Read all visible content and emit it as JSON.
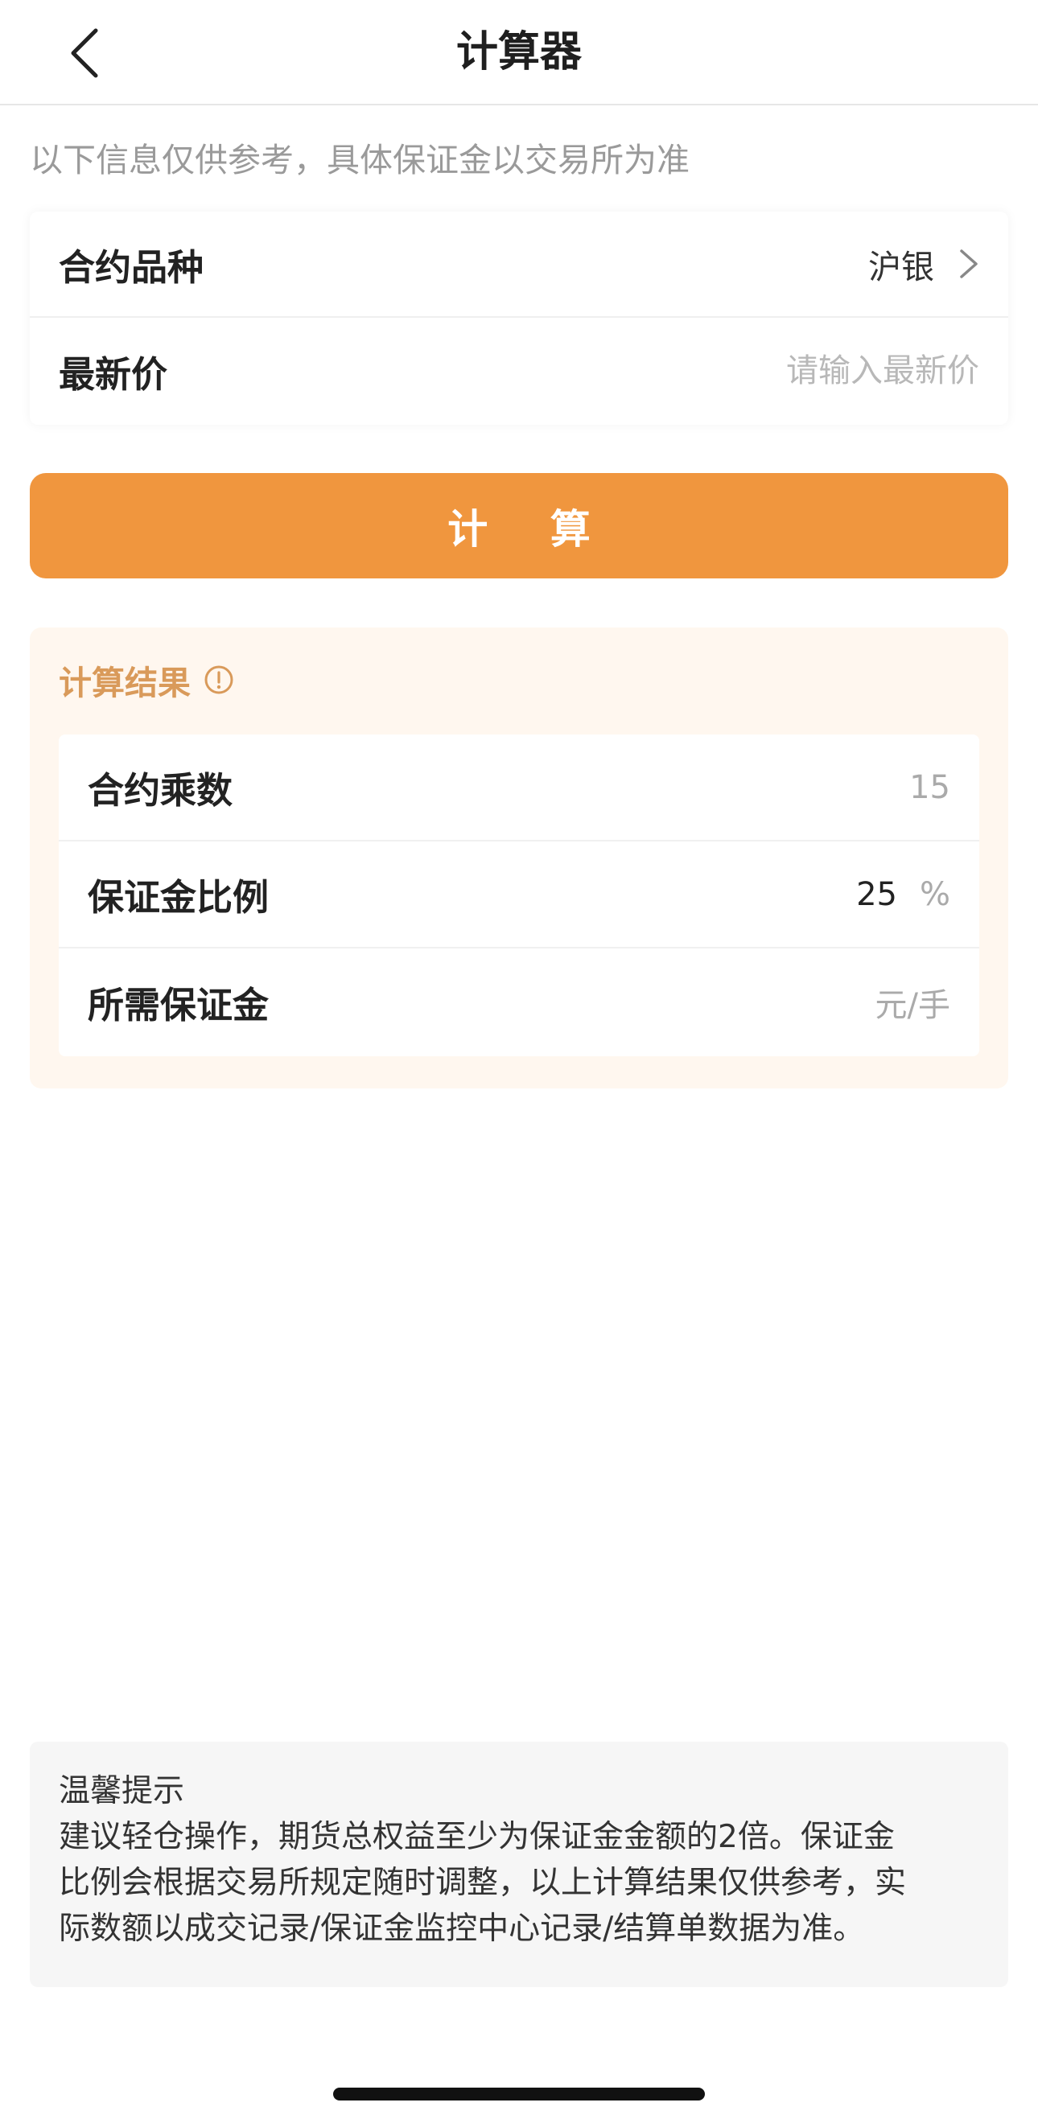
{
  "navbar": {
    "title": "计算器"
  },
  "notice": "以下信息仅供参考，具体保证金以交易所为准",
  "form": {
    "contract_label": "合约品种",
    "contract_value": "沪银",
    "price_label": "最新价",
    "price_placeholder": "请输入最新价",
    "price_value": ""
  },
  "calculate_button": "计 算",
  "result": {
    "title": "计算结果",
    "rows": [
      {
        "label": "合约乘数",
        "value": "15",
        "unit": ""
      },
      {
        "label": "保证金比例",
        "value": "25",
        "unit": "%"
      },
      {
        "label": "所需保证金",
        "value": "",
        "unit": "元/手"
      }
    ]
  },
  "tips": {
    "title": "温馨提示",
    "lines": [
      "建议轻仓操作，期货总权益至少为保证金金额的2倍。保证金",
      "比例会根据交易所规定随时调整，以上计算结果仅供参考，实",
      "际数额以成交记录/保证金监控中心记录/结算单数据为准。"
    ]
  },
  "icons": {
    "back": "chevron-left-icon",
    "contract_arrow": "chevron-right-icon",
    "info": "info-circle-icon"
  },
  "colors": {
    "accent": "#f0963e",
    "result_title": "#d99a5a",
    "result_bg": "#fff7ef",
    "tips_bg": "#f6f6f6"
  }
}
